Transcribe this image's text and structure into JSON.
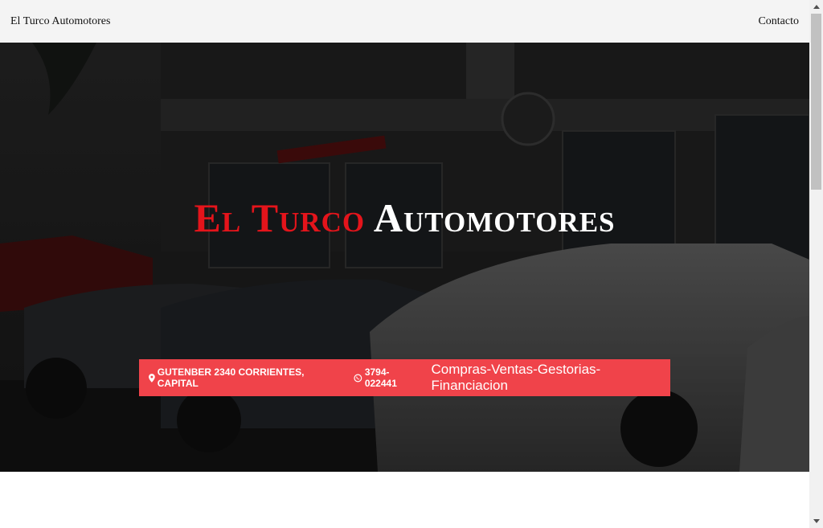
{
  "navbar": {
    "brand": "El Turco Automotores",
    "contact_link": "Contacto"
  },
  "hero": {
    "title_red": "El Turco",
    "title_white": "Automotores",
    "background_image": "car dealership storefront with parked cars"
  },
  "info_bar": {
    "address": "GUTENBER 2340 CORRIENTES, CAPITAL",
    "phone": "3794-022441",
    "services": "Compras-Ventas-Gestorias-Financiacion",
    "location_icon": "map-marker-icon",
    "phone_icon": "whatsapp-icon"
  },
  "colors": {
    "accent_red": "#e4141b",
    "info_bar_bg": "#f0434a",
    "navbar_bg": "#f4f4f4"
  }
}
